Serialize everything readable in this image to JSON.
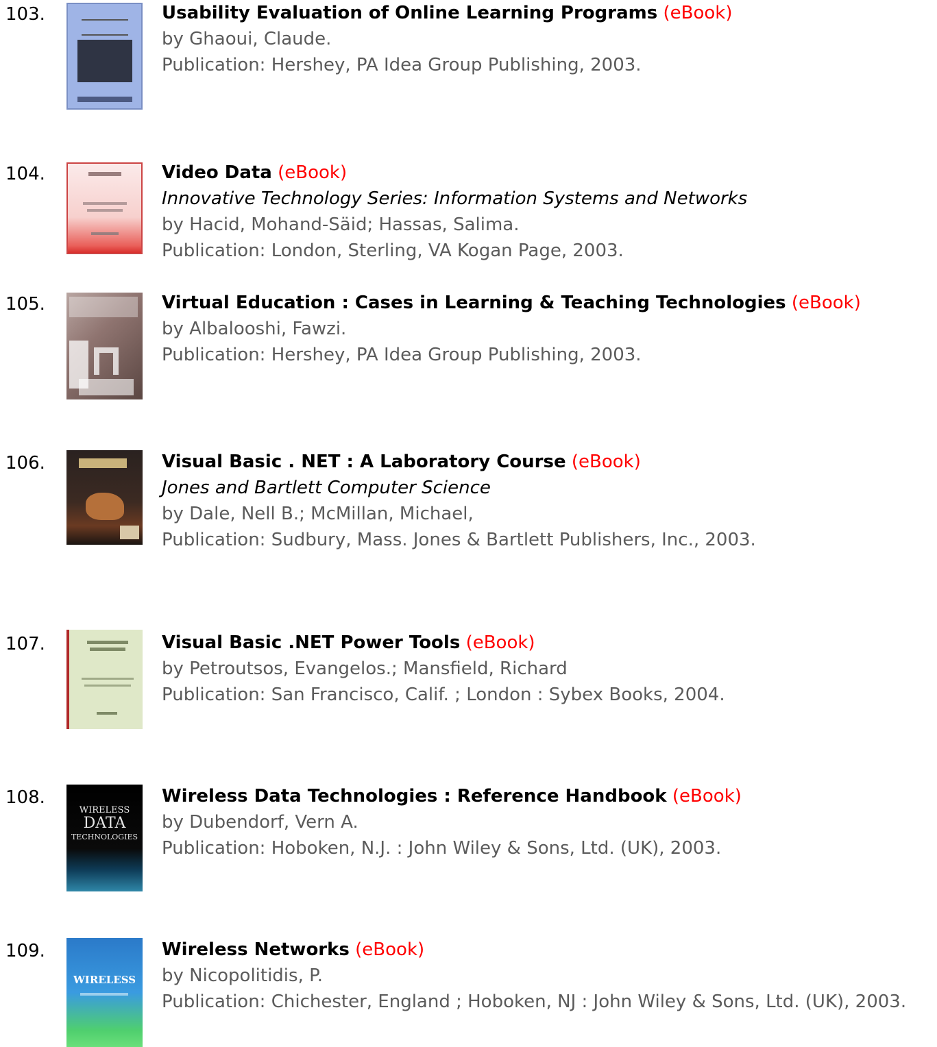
{
  "records": [
    {
      "number": "103.",
      "title": "Usability Evaluation of Online Learning Programs",
      "format": "(eBook)",
      "authors": "by Ghaoui, Claude.",
      "publication": "Publication: Hershey, PA Idea Group Publishing, 2003."
    },
    {
      "number": "104.",
      "title": "Video Data",
      "format": "(eBook)",
      "series": "Innovative Technology Series: Information Systems and Networks",
      "authors": "by Hacid, Mohand-Säid; Hassas, Salima.",
      "publication": "Publication: London, Sterling, VA Kogan Page, 2003."
    },
    {
      "number": "105.",
      "title": "Virtual Education : Cases in Learning & Teaching Technologies",
      "format": "(eBook)",
      "authors": "by Albalooshi, Fawzi.",
      "publication": "Publication: Hershey, PA Idea Group Publishing, 2003."
    },
    {
      "number": "106.",
      "title": "Visual Basic . NET : A Laboratory Course",
      "format": "(eBook)",
      "series": "Jones and Bartlett Computer Science",
      "authors": "by Dale, Nell B.; McMillan, Michael,",
      "publication": "Publication: Sudbury, Mass. Jones & Bartlett Publishers, Inc., 2003."
    },
    {
      "number": "107.",
      "title": "Visual Basic .NET Power Tools",
      "format": "(eBook)",
      "authors": "by Petroutsos, Evangelos.; Mansfield, Richard",
      "publication": "Publication: San Francisco, Calif. ; London : Sybex Books, 2004."
    },
    {
      "number": "108.",
      "title": "Wireless Data Technologies : Reference Handbook",
      "format": "(eBook)",
      "authors": "by Dubendorf, Vern A.",
      "publication": "Publication: Hoboken, N.J. : John Wiley & Sons, Ltd. (UK), 2003.",
      "cover_text": [
        "WIRELESS",
        "DATA",
        "TECHNOLOGIES"
      ]
    },
    {
      "number": "109.",
      "title": "Wireless Networks",
      "format": "(eBook)",
      "authors": "by Nicopolitidis, P.",
      "publication": "Publication: Chichester, England ; Hoboken, NJ : John Wiley & Sons, Ltd. (UK), 2003.",
      "cover_text": [
        "WIRELESS"
      ]
    }
  ],
  "colors": {
    "format_label": "#ff0000",
    "title": "#000000",
    "body_text": "#5b5b5b"
  }
}
